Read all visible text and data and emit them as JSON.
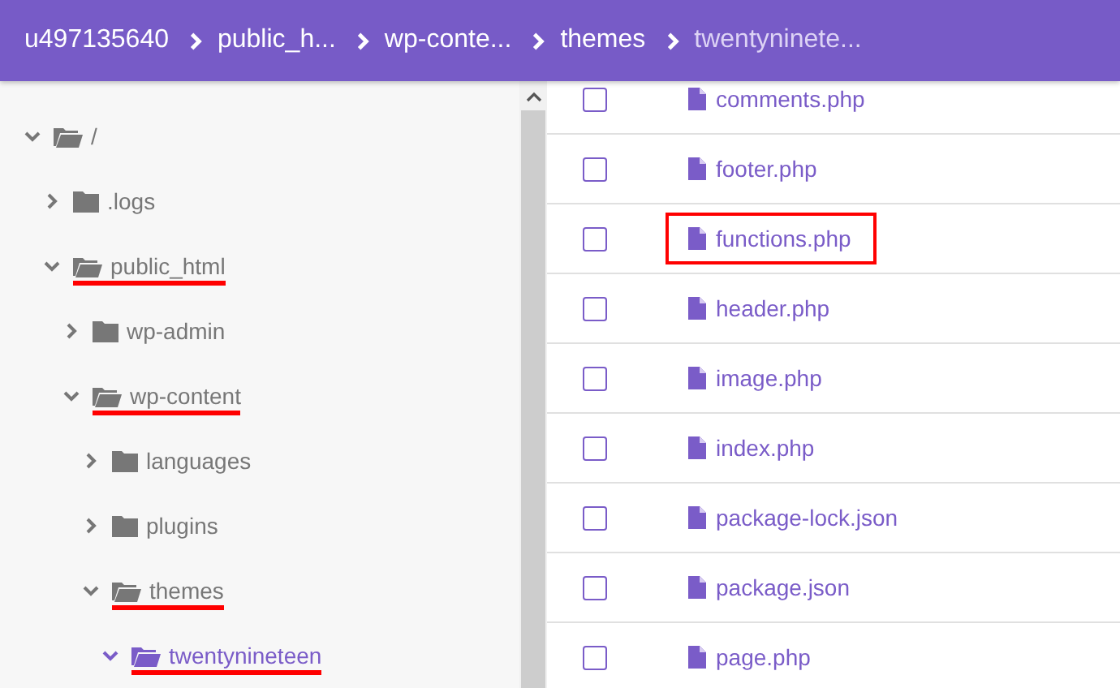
{
  "breadcrumb": [
    {
      "label": "u497135640",
      "current": false
    },
    {
      "label": "public_h...",
      "current": false
    },
    {
      "label": "wp-conte...",
      "current": false
    },
    {
      "label": "themes",
      "current": false
    },
    {
      "label": "twentyninete...",
      "current": true
    }
  ],
  "tree": [
    {
      "label": "/",
      "expanded": true,
      "selected": false,
      "highlighted": false,
      "children": [
        {
          "label": ".logs",
          "expanded": false,
          "selected": false,
          "highlighted": false
        },
        {
          "label": "public_html",
          "expanded": true,
          "selected": false,
          "highlighted": true,
          "children": [
            {
              "label": "wp-admin",
              "expanded": false,
              "selected": false,
              "highlighted": false
            },
            {
              "label": "wp-content",
              "expanded": true,
              "selected": false,
              "highlighted": true,
              "children": [
                {
                  "label": "languages",
                  "expanded": false,
                  "selected": false,
                  "highlighted": false
                },
                {
                  "label": "plugins",
                  "expanded": false,
                  "selected": false,
                  "highlighted": false
                },
                {
                  "label": "themes",
                  "expanded": true,
                  "selected": false,
                  "highlighted": true,
                  "children": [
                    {
                      "label": "twentynineteen",
                      "expanded": true,
                      "selected": true,
                      "highlighted": true
                    }
                  ]
                }
              ]
            }
          ]
        }
      ]
    }
  ],
  "files": [
    {
      "name": "comments.php",
      "checked": false,
      "highlighted": false
    },
    {
      "name": "footer.php",
      "checked": false,
      "highlighted": false
    },
    {
      "name": "functions.php",
      "checked": false,
      "highlighted": true
    },
    {
      "name": "header.php",
      "checked": false,
      "highlighted": false
    },
    {
      "name": "image.php",
      "checked": false,
      "highlighted": false
    },
    {
      "name": "index.php",
      "checked": false,
      "highlighted": false
    },
    {
      "name": "package-lock.json",
      "checked": false,
      "highlighted": false
    },
    {
      "name": "package.json",
      "checked": false,
      "highlighted": false
    },
    {
      "name": "page.php",
      "checked": false,
      "highlighted": false
    }
  ]
}
